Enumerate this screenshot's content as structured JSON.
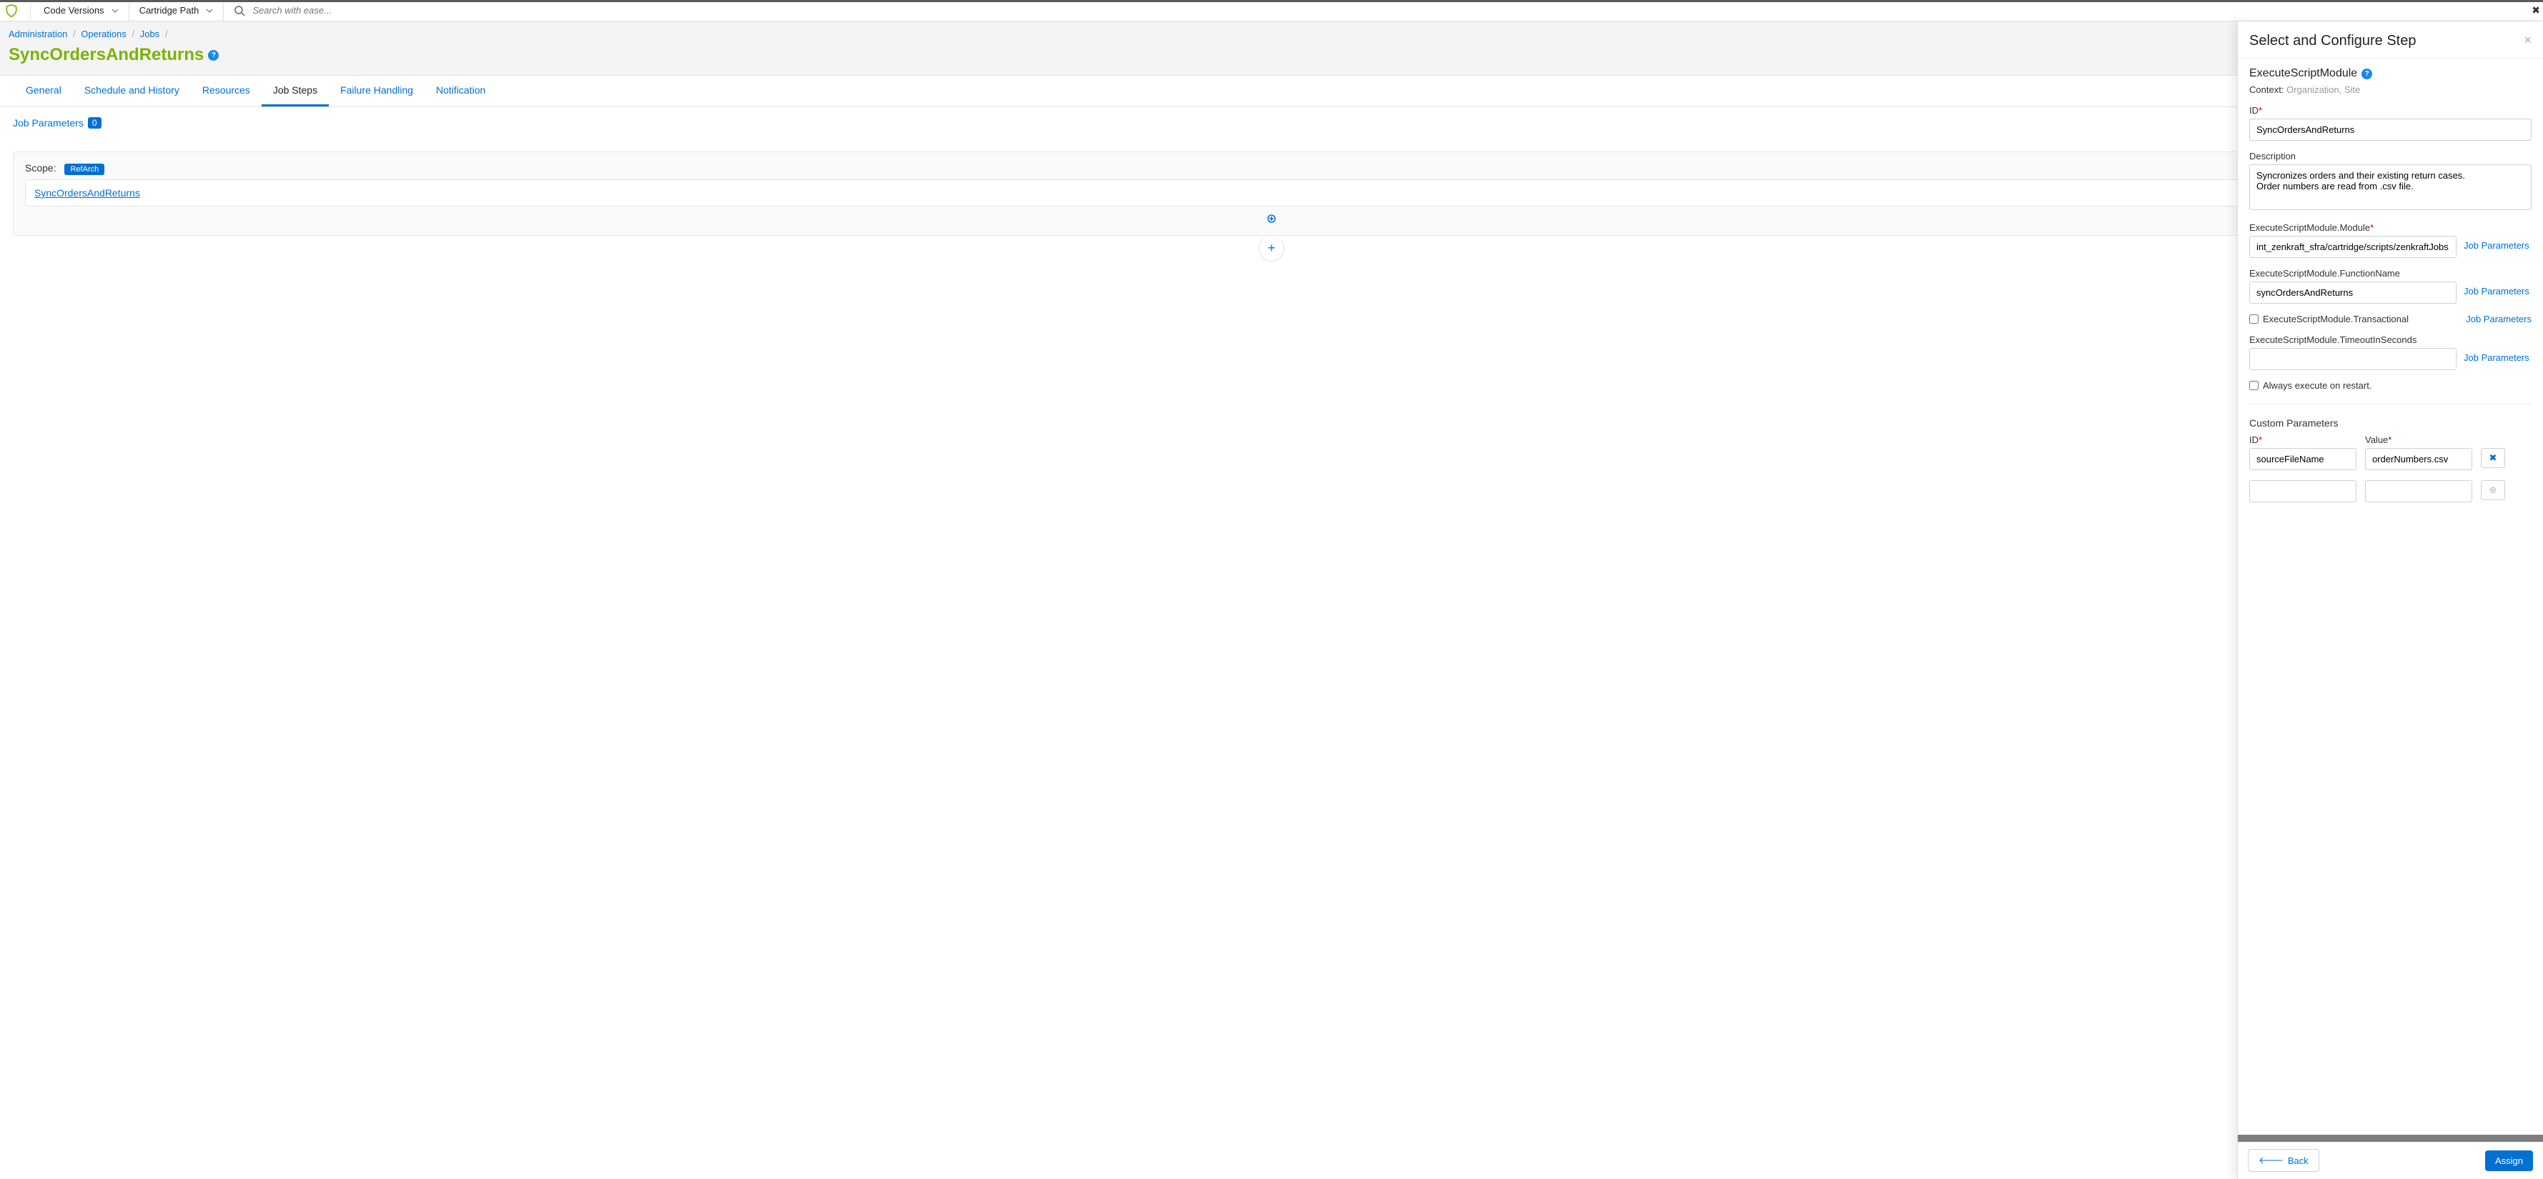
{
  "topbar": {
    "menus": [
      "Code Versions",
      "Cartridge Path"
    ],
    "search_placeholder": "Search with ease..."
  },
  "breadcrumb": [
    "Administration",
    "Operations",
    "Jobs"
  ],
  "page_title": "SyncOrdersAndReturns",
  "tabs": [
    "General",
    "Schedule and History",
    "Resources",
    "Job Steps",
    "Failure Handling",
    "Notification"
  ],
  "active_tab_index": 3,
  "job_params": {
    "label": "Job Parameters",
    "count": "0"
  },
  "scope": {
    "label": "Scope:",
    "tag": "RefArch"
  },
  "steps": [
    {
      "name": "SyncOrdersAndReturns"
    }
  ],
  "panel": {
    "title": "Select and Configure Step",
    "module_type": "ExecuteScriptModule",
    "context_label": "Context:",
    "context_value": "Organization, Site",
    "fields": {
      "id_label": "ID",
      "id_value": "SyncOrdersAndReturns",
      "desc_label": "Description",
      "desc_value": "Syncronizes orders and their existing return cases.\nOrder numbers are read from .csv file.",
      "module_label": "ExecuteScriptModule.Module",
      "module_value": "int_zenkraft_sfra/cartridge/scripts/zenkraftJobs.js",
      "fn_label": "ExecuteScriptModule.FunctionName",
      "fn_value": "syncOrdersAndReturns",
      "transactional_label": "ExecuteScriptModule.Transactional",
      "timeout_label": "ExecuteScriptModule.TimeoutInSeconds",
      "timeout_value": "",
      "always_label": "Always execute on restart.",
      "job_param_link": "Job Parameters"
    },
    "custom": {
      "title": "Custom Parameters",
      "id_label": "ID",
      "value_label": "Value",
      "rows": [
        {
          "id": "sourceFileName",
          "value": "orderNumbers.csv"
        },
        {
          "id": "",
          "value": ""
        }
      ]
    },
    "footer": {
      "back": "Back",
      "assign": "Assign"
    }
  }
}
